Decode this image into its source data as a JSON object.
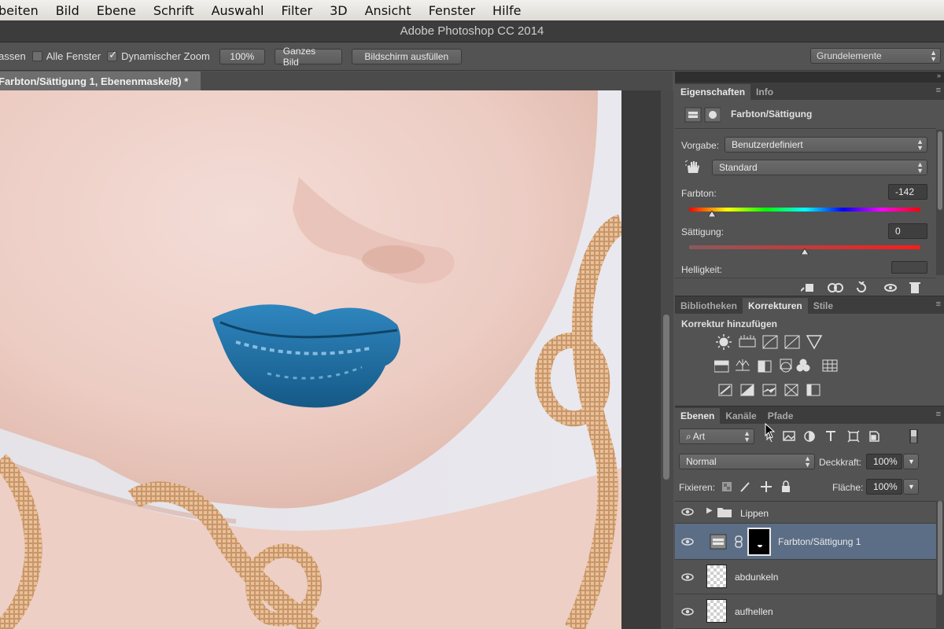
{
  "menu": [
    "beiten",
    "Bild",
    "Ebene",
    "Schrift",
    "Auswahl",
    "Filter",
    "3D",
    "Ansicht",
    "Fenster",
    "Hilfe"
  ],
  "window_title": "Adobe Photoshop CC 2014",
  "options": {
    "fit_cut": "assen",
    "all_windows": "Alle Fenster",
    "dynamic_zoom": "Dynamischer Zoom",
    "zoom": "100%",
    "whole_image": "Ganzes Bild",
    "fill_screen": "Bildschirm ausfüllen",
    "workspace": "Grundelemente"
  },
  "doc_tab": "Farbton/Sättigung 1, Ebenenmaske/8) *",
  "properties": {
    "tabs": [
      "Eigenschaften",
      "Info"
    ],
    "title": "Farbton/Sättigung",
    "preset_label": "Vorgabe:",
    "preset_value": "Benutzerdefiniert",
    "channel_value": "Standard",
    "hue_label": "Farbton:",
    "hue_value": "-142",
    "hue_slider_fraction": 0.1,
    "saturation_label": "Sättigung:",
    "saturation_value": "0",
    "saturation_slider_fraction": 0.5,
    "lightness_label": "Helligkeit:"
  },
  "adjustments": {
    "tabs": [
      "Bibliotheken",
      "Korrekturen",
      "Stile"
    ],
    "title": "Korrektur hinzufügen"
  },
  "layers": {
    "tabs": [
      "Ebenen",
      "Kanäle",
      "Pfade"
    ],
    "filter_kind": "Art",
    "blend_mode": "Normal",
    "opacity_label": "Deckkraft:",
    "opacity_value": "100%",
    "lock_label": "Fixieren:",
    "fill_label": "Fläche:",
    "fill_value": "100%",
    "items": [
      {
        "name": "Lippen"
      },
      {
        "name": "Farbton/Sättigung 1"
      },
      {
        "name": "abdunkeln"
      },
      {
        "name": "aufhellen"
      }
    ]
  },
  "colors": {
    "lip_blue": "#1d6fa6",
    "chain_gold": "#c9966a",
    "selected_layer": "#5c6d86"
  }
}
